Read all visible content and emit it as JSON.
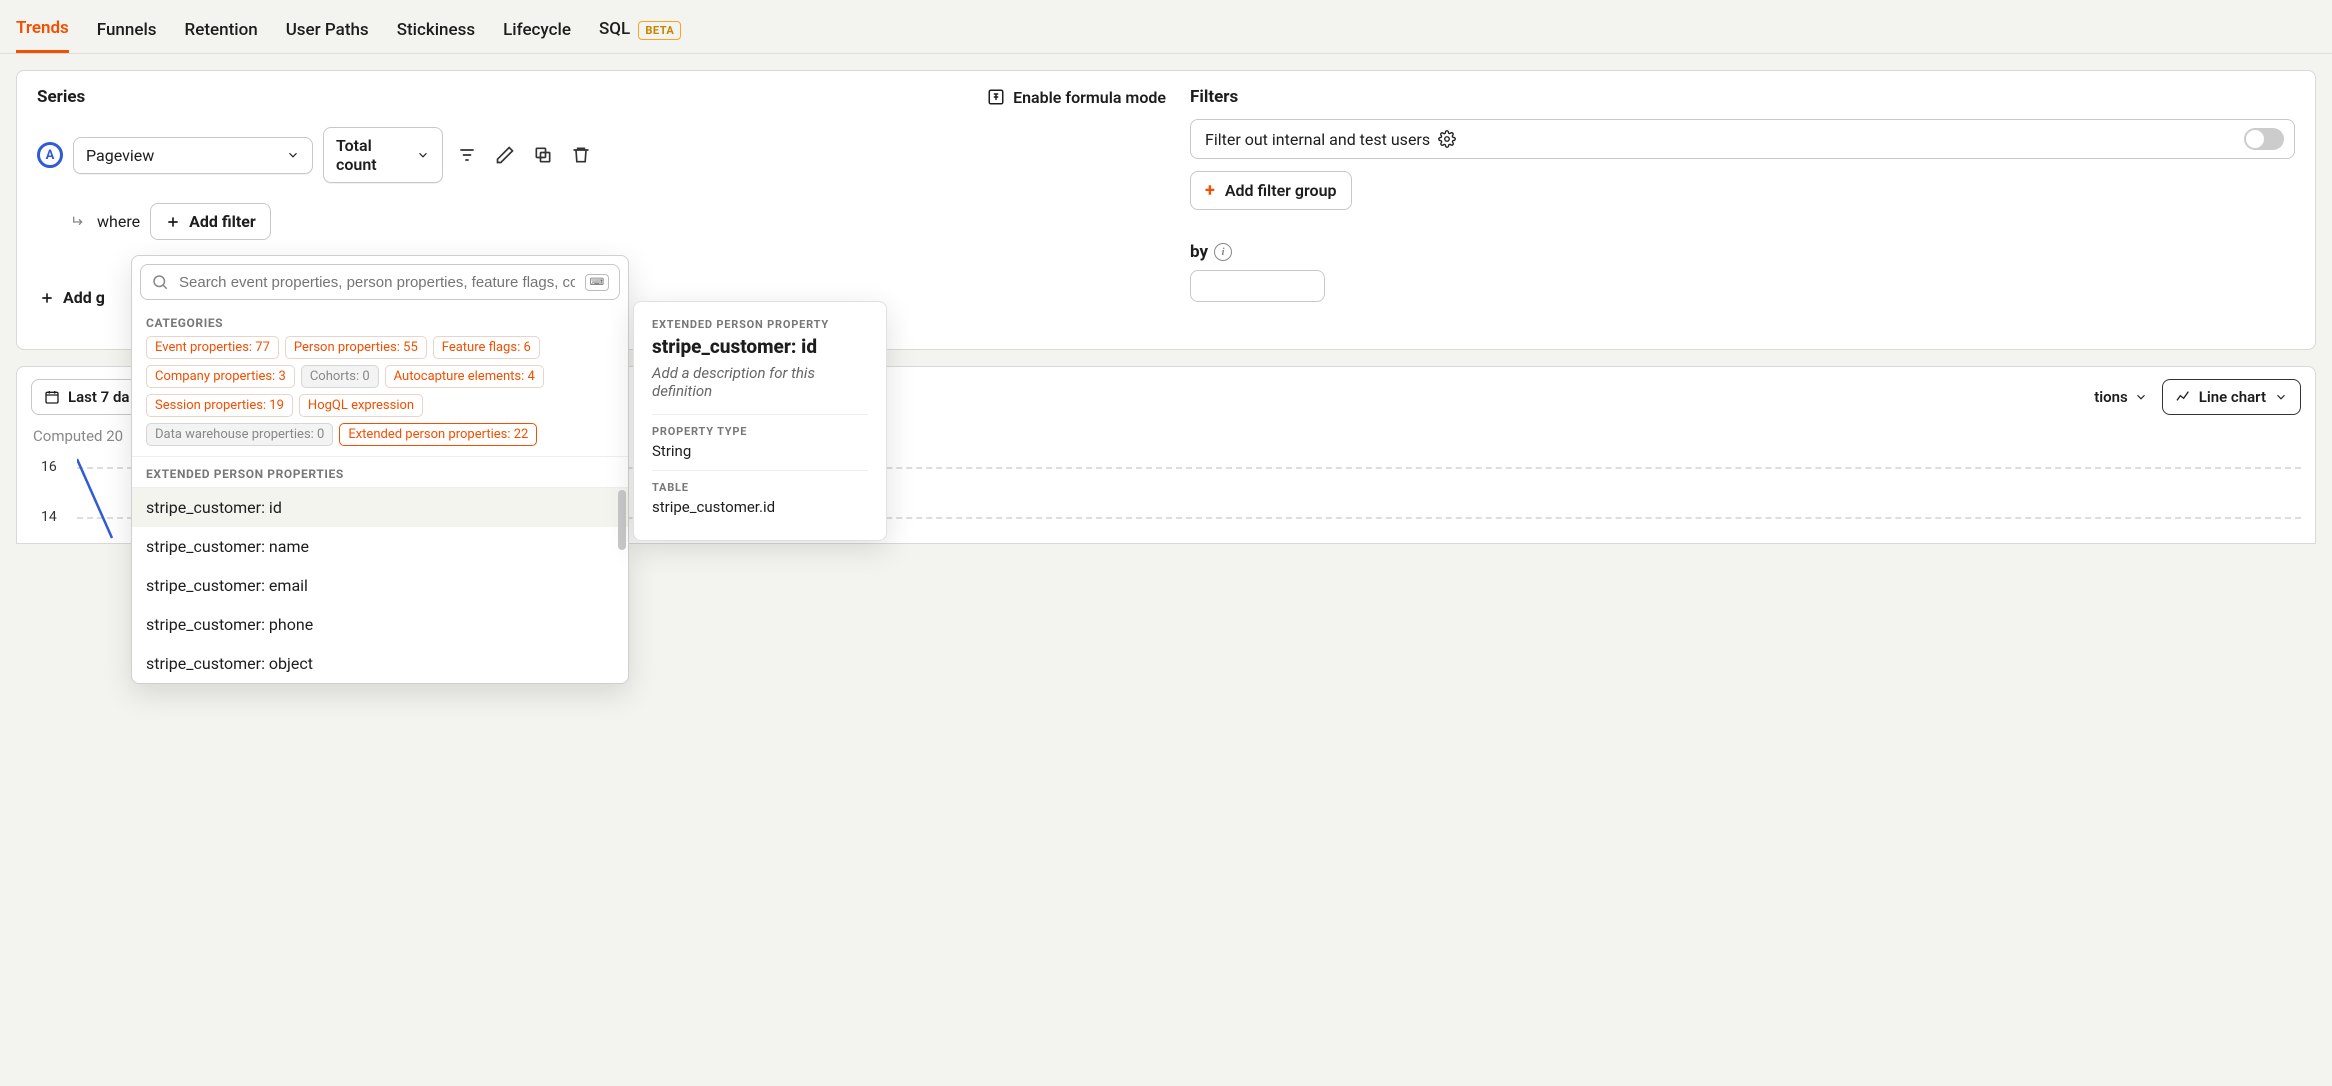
{
  "tabs": {
    "trends": "Trends",
    "funnels": "Funnels",
    "retention": "Retention",
    "user_paths": "User Paths",
    "stickiness": "Stickiness",
    "lifecycle": "Lifecycle",
    "sql": "SQL",
    "beta_badge": "BETA",
    "active": "trends"
  },
  "series": {
    "title": "Series",
    "formula_toggle": "Enable formula mode",
    "badge_letter": "A",
    "event": "Pageview",
    "aggregation": "Total count",
    "where_label": "where",
    "add_filter": "Add filter",
    "add_graph": "Add g"
  },
  "filters": {
    "title": "Filters",
    "internal_users": "Filter out internal and test users",
    "add_filter_group": "Add filter group",
    "breakdown_by": "by"
  },
  "popover": {
    "search_placeholder": "Search event properties, person properties, feature flags, cohorts, autocap",
    "categories_label": "CATEGORIES",
    "categories": [
      {
        "label": "Event properties: 77",
        "type": "active"
      },
      {
        "label": "Person properties: 55",
        "type": "active"
      },
      {
        "label": "Feature flags: 6",
        "type": "active"
      },
      {
        "label": "Company properties: 3",
        "type": "active"
      },
      {
        "label": "Cohorts: 0",
        "type": "muted"
      },
      {
        "label": "Autocapture elements: 4",
        "type": "active"
      },
      {
        "label": "Session properties: 19",
        "type": "active"
      },
      {
        "label": "HogQL expression",
        "type": "active"
      },
      {
        "label": "Data warehouse properties: 0",
        "type": "muted"
      },
      {
        "label": "Extended person properties: 22",
        "type": "selected"
      }
    ],
    "list_label": "EXTENDED PERSON PROPERTIES",
    "items": [
      "stripe_customer: id",
      "stripe_customer: name",
      "stripe_customer: email",
      "stripe_customer: phone",
      "stripe_customer: object"
    ],
    "selected_index": 0
  },
  "detail": {
    "header_label": "EXTENDED PERSON PROPERTY",
    "title": "stripe_customer: id",
    "description": "Add a description for this definition",
    "type_label": "PROPERTY TYPE",
    "type_value": "String",
    "table_label": "TABLE",
    "table_value": "stripe_customer.id"
  },
  "lower": {
    "date_range": "Last 7 da",
    "options": "tions",
    "chart_type": "Line chart",
    "computed": "Computed 20"
  },
  "chart_data": {
    "type": "line",
    "x": [
      0,
      1
    ],
    "values": [
      16,
      13
    ],
    "y_ticks": [
      16,
      14
    ],
    "ylim": [
      12,
      17
    ],
    "xlabel": "",
    "ylabel": "",
    "title": ""
  }
}
